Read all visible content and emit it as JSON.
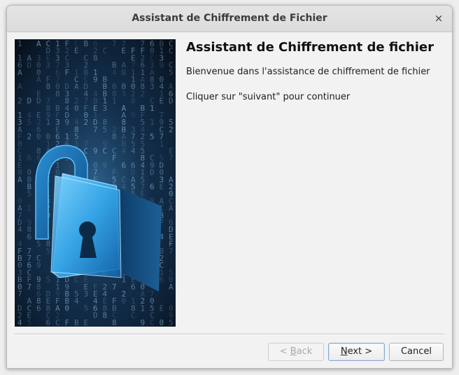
{
  "window": {
    "title": "Assistant de Chiffrement de Fichier",
    "close_glyph": "×"
  },
  "banner": {
    "icon": "padlock-digital-security-image",
    "colors": {
      "background": "#0b1a2b",
      "lock": "#2fa6e8"
    }
  },
  "content": {
    "heading": "Assistant de Chiffrement de fichier",
    "welcome": "Bienvenue dans l'assistance de chiffrement de fichier",
    "instruction": "Cliquer sur \"suivant\" pour continuer"
  },
  "buttons": {
    "back": {
      "prefix": "< ",
      "mnemonic": "B",
      "rest": "ack",
      "enabled": false
    },
    "next": {
      "mnemonic": "N",
      "rest": "ext >",
      "enabled": true
    },
    "cancel": {
      "label": "Cancel",
      "enabled": true
    }
  }
}
